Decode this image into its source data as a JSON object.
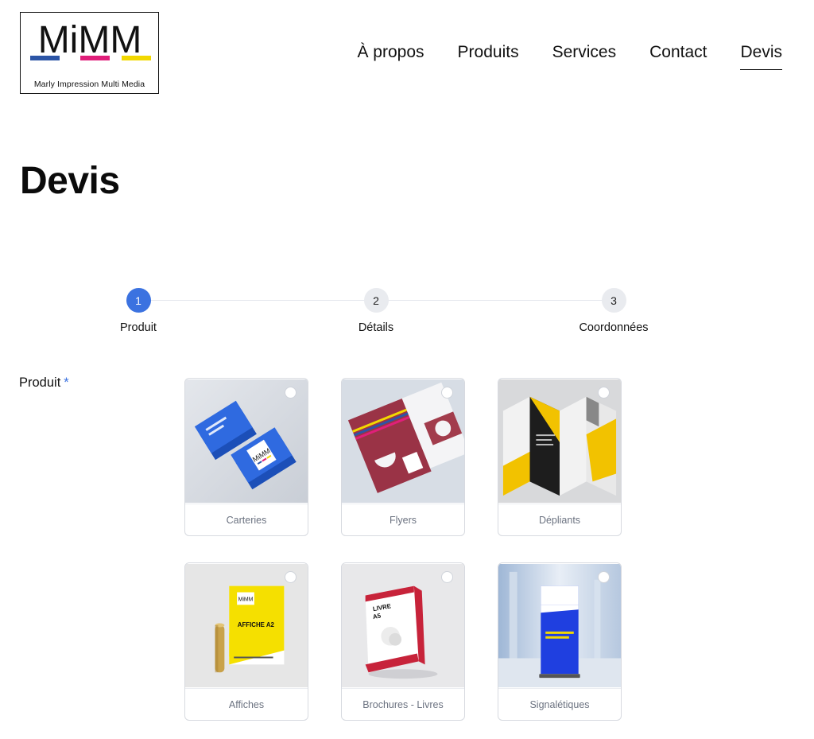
{
  "brand": {
    "logo_text": "MiMM",
    "tagline": "Marly Impression Multi Media",
    "colors": {
      "blue": "#2c55a6",
      "magenta": "#e01f7a",
      "yellow": "#f2d800"
    }
  },
  "nav": {
    "items": [
      {
        "label": "À propos"
      },
      {
        "label": "Produits"
      },
      {
        "label": "Services"
      },
      {
        "label": "Contact"
      },
      {
        "label": "Devis",
        "active": true
      }
    ]
  },
  "page": {
    "title": "Devis"
  },
  "steps": {
    "accent": "#3b72e0",
    "items": [
      {
        "number": "1",
        "label": "Produit",
        "current": true
      },
      {
        "number": "2",
        "label": "Détails"
      },
      {
        "number": "3",
        "label": "Coordonnées"
      }
    ]
  },
  "form": {
    "product_label": "Produit",
    "required_mark": "*",
    "products": [
      {
        "label": "Carteries",
        "icon": "business-cards-image"
      },
      {
        "label": "Flyers",
        "icon": "flyers-image"
      },
      {
        "label": "Dépliants",
        "icon": "leaflets-image"
      },
      {
        "label": "Affiches",
        "icon": "poster-image"
      },
      {
        "label": "Brochures - Livres",
        "icon": "book-image"
      },
      {
        "label": "Signalétiques",
        "icon": "rollup-banner-image"
      }
    ]
  },
  "images": {
    "card_logo": "MiMM",
    "poster_title": "AFFICHE A2",
    "book_title": "LIVRE",
    "book_size": "A5"
  }
}
